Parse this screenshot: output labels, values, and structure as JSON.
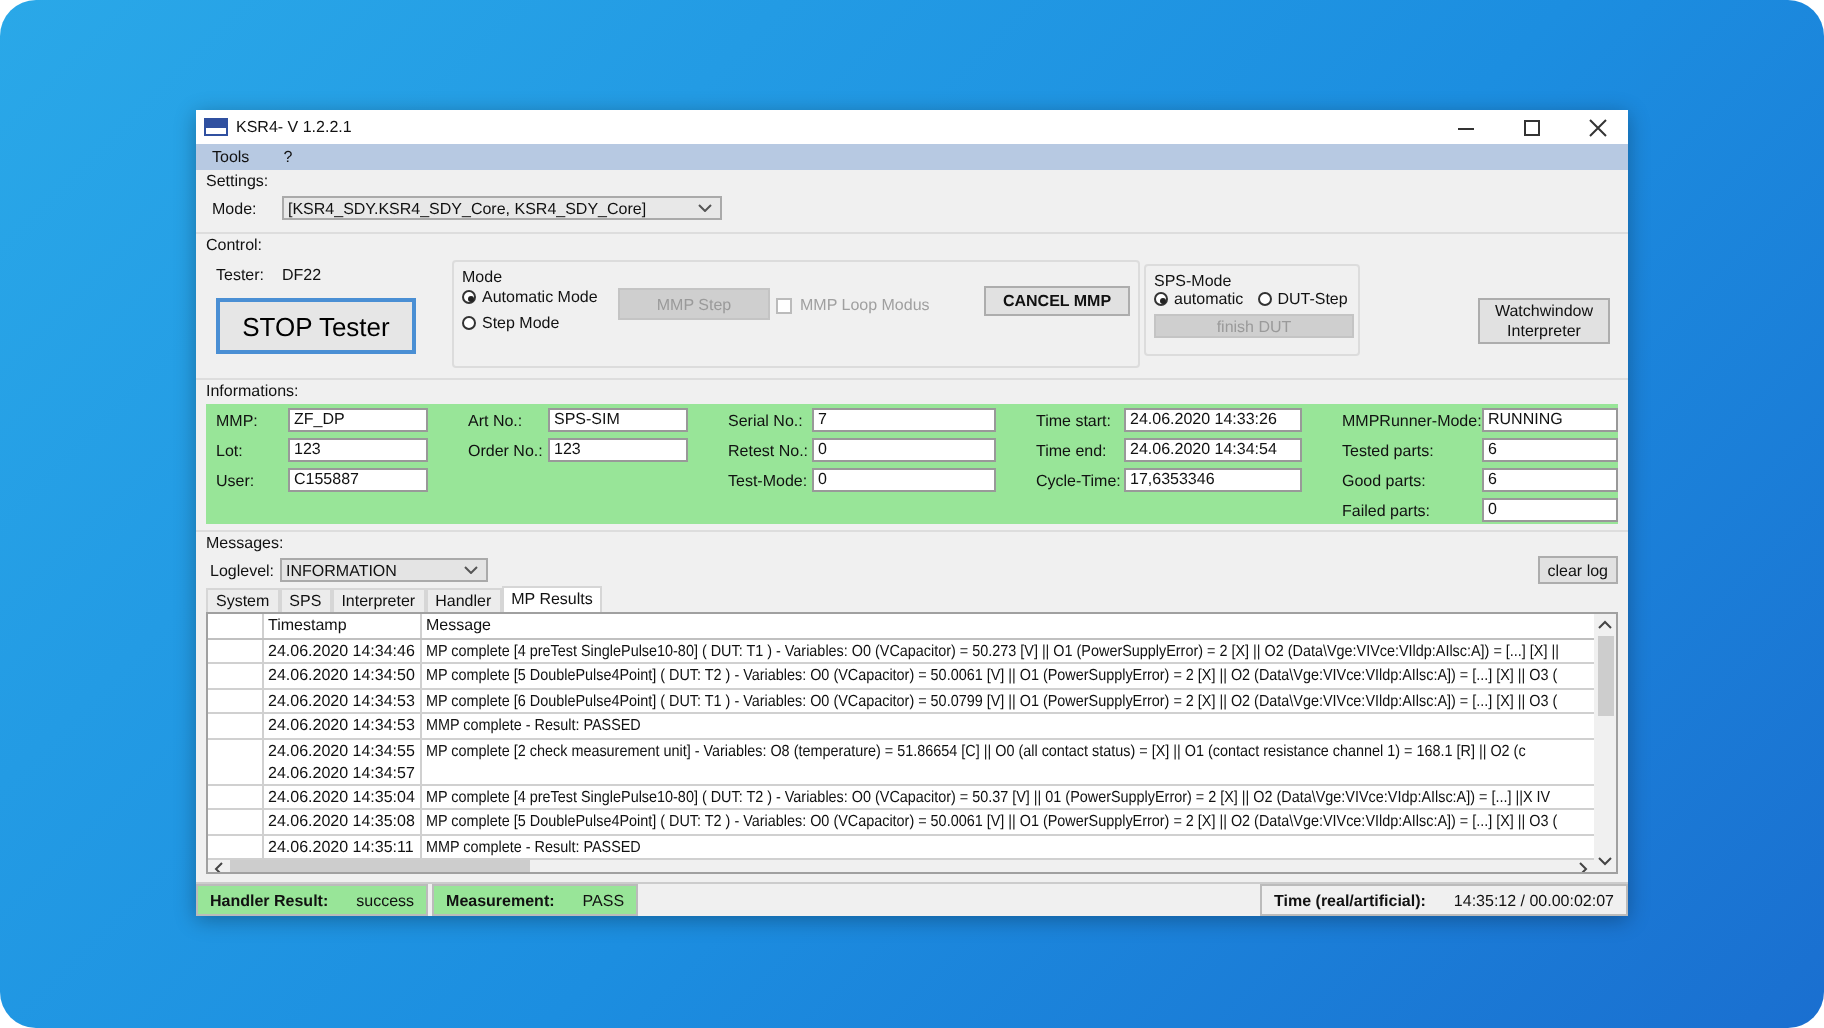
{
  "window": {
    "title": "KSR4- V 1.2.2.1"
  },
  "menu": [
    "Tools",
    "?"
  ],
  "settings": {
    "heading": "Settings:",
    "mode_label": "Mode:",
    "mode_value": "[KSR4_SDY.KSR4_SDY_Core, KSR4_SDY_Core]"
  },
  "control": {
    "heading": "Control:",
    "tester_label": "Tester:",
    "tester_value": "DF22",
    "stop_button": "STOP Tester",
    "mode_group": {
      "title": "Mode",
      "options": [
        {
          "label": "Automatic Mode",
          "selected": true
        },
        {
          "label": "Step Mode",
          "selected": false
        }
      ],
      "step_button": {
        "label": "MMP Step",
        "disabled": true
      },
      "loop_checkbox": {
        "label": "MMP Loop Modus",
        "checked": false,
        "disabled": true
      },
      "cancel_button": "CANCEL MMP"
    },
    "sps_mode": {
      "title": "SPS-Mode",
      "options": [
        {
          "label": "automatic",
          "selected": true
        },
        {
          "label": "DUT-Step",
          "selected": false
        }
      ],
      "finish_button": {
        "label": "finish DUT",
        "disabled": true
      }
    },
    "watch_button": "Watchwindow Interpreter"
  },
  "informations": {
    "heading": "Informations:",
    "columns": [
      [
        {
          "label": "MMP:",
          "value": "ZF_DP"
        },
        {
          "label": "Lot:",
          "value": "123"
        },
        {
          "label": "User:",
          "value": "C155887"
        }
      ],
      [
        {
          "label": "Art No.:",
          "value": "SPS-SIM"
        },
        {
          "label": "Order No.:",
          "value": "123"
        }
      ],
      [
        {
          "label": "Serial No.:",
          "value": "7"
        },
        {
          "label": "Retest No.:",
          "value": "0"
        },
        {
          "label": "Test-Mode:",
          "value": "0"
        }
      ],
      [
        {
          "label": "Time start:",
          "value": "24.06.2020 14:33:26"
        },
        {
          "label": "Time end:",
          "value": "24.06.2020 14:34:54"
        },
        {
          "label": "Cycle-Time:",
          "value": "17,6353346"
        }
      ],
      [
        {
          "label": "MMPRunner-Mode:",
          "value": "RUNNING"
        },
        {
          "label": "Tested parts:",
          "value": "6"
        },
        {
          "label": "Good parts:",
          "value": "6"
        },
        {
          "label": "Failed parts:",
          "value": "0"
        }
      ]
    ]
  },
  "messages": {
    "heading": "Messages:",
    "loglevel_label": "Loglevel:",
    "loglevel_value": "INFORMATION",
    "clear_button": "clear log",
    "tabs": [
      {
        "label": "System",
        "selected": false
      },
      {
        "label": "SPS",
        "selected": false
      },
      {
        "label": "Interpreter",
        "selected": false
      },
      {
        "label": "Handler",
        "selected": false
      },
      {
        "label": "MP Results",
        "selected": true
      }
    ],
    "columns": [
      "Timestamp",
      "Message"
    ],
    "rows": [
      {
        "timestamps": [
          "24.06.2020 14:34:46"
        ],
        "message": "MP complete [4 preTest SinglePulse10-80] ( DUT: T1 )  - Variables: O0 (VCapacitor) = 50.273 [V] || O1 (PowerSupplyError) = 2 [X] || O2 (Data\\Vge:VIVce:VIldp:AIlsc:A]) = [...] [X] ||"
      },
      {
        "timestamps": [
          "24.06.2020 14:34:50"
        ],
        "message": "MP complete [5  DoublePulse4Point] ( DUT: T2 )  - Variables: O0 (VCapacitor) = 50.0061 [V] || O1 (PowerSupplyError) = 2 [X] || O2 (Data\\Vge:VIVce:VIldp:AIlsc:A]) = [...] [X] || O3 ("
      },
      {
        "timestamps": [
          "24.06.2020 14:34:53"
        ],
        "message": "MP complete [6  DoublePulse4Point] ( DUT: T1 )  - Variables: O0 (VCapacitor) = 50.0799 [V] || O1 (PowerSupplyError) = 2 [X] || O2 (Data\\Vge:VIVce:VIldp:AIlsc:A]) = [...] [X] || O3 ("
      },
      {
        "timestamps": [
          "24.06.2020 14:34:53"
        ],
        "message": "MMP complete - Result: PASSED"
      },
      {
        "timestamps": [
          "24.06.2020 14:34:55",
          "24.06.2020 14:34:57"
        ],
        "message": "MP complete [2 check measurement unit]  - Variables: O8 (temperature) = 51.86654 [C] || O0 (all contact status) = [X] || O1 (contact resistance channel 1) = 168.1 [R] || O2 (c"
      },
      {
        "timestamps": [
          "24.06.2020 14:35:04"
        ],
        "message": "MP complete [4 preTest SinglePulse10-80] ( DUT: T2 )  - Variables: O0 (VCapacitor) = 50.37 [V] || 01 (PowerSupplyError) = 2 [X] || O2 (Data\\Vge:VIVce:VIdp:AIlsc:A]) = [...] ||X IV"
      },
      {
        "timestamps": [
          "24.06.2020 14:35:08"
        ],
        "message": "MP complete [5  DoublePulse4Point] ( DUT: T2 )  - Variables: O0 (VCapacitor) = 50.0061 [V] || O1 (PowerSupplyError) = 2 [X] || O2 (Data\\Vge:VIVce:VIldp:AIlsc:A]) = [...] [X] || O3 ("
      },
      {
        "timestamps": [
          "24.06.2020 14:35:11"
        ],
        "message": "MMP complete - Result: PASSED"
      }
    ]
  },
  "status_bar": [
    {
      "label": "Handler Result:",
      "value": "success",
      "highlighted": true
    },
    {
      "label": "Measurement:",
      "value": "PASS",
      "highlighted": true
    },
    {
      "label": "Time (real/artificial):",
      "value": "14:35:12 / 00.00:02:07",
      "highlighted": false
    }
  ]
}
